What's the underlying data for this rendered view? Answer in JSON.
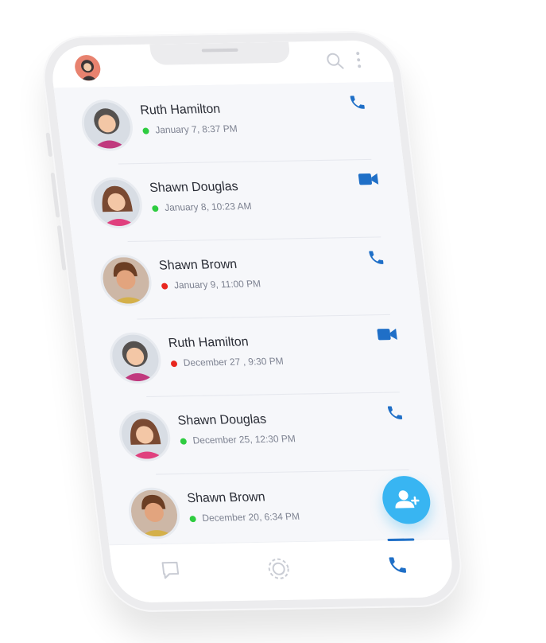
{
  "colors": {
    "accent": "#1f6fc7",
    "fab": "#38b5f2",
    "online": "#2ecc40",
    "missed": "#e8261e"
  },
  "header": {
    "avatar_icon": "user-avatar-icon",
    "search_icon": "search-icon",
    "menu_icon": "more-vertical-icon"
  },
  "calls": [
    {
      "name": "Ruth Hamilton",
      "time": "January 7, 8:37 PM",
      "status": "online",
      "action_icon": "phone-icon",
      "avatar": "woman-curly-hair"
    },
    {
      "name": "Shawn Douglas",
      "time": "January 8, 10:23 AM",
      "status": "online",
      "action_icon": "video-icon",
      "avatar": "woman-brown-hair"
    },
    {
      "name": "Shawn Brown",
      "time": "January 9, 11:00 PM",
      "status": "missed",
      "action_icon": "phone-icon",
      "avatar": "man-brown-hair"
    },
    {
      "name": "Ruth Hamilton",
      "time": "December 27 , 9:30 PM",
      "status": "missed",
      "action_icon": "video-icon",
      "avatar": "woman-curly-hair"
    },
    {
      "name": "Shawn Douglas",
      "time": "December 25, 12:30 PM",
      "status": "online",
      "action_icon": "phone-icon",
      "avatar": "woman-brown-hair"
    },
    {
      "name": "Shawn Brown",
      "time": "December 20, 6:34 PM",
      "status": "online",
      "action_icon": "phone-icon",
      "avatar": "man-brown-hair"
    }
  ],
  "fab": {
    "icon": "add-user-icon"
  },
  "bottom_nav": [
    {
      "icon": "chat-icon",
      "active": false
    },
    {
      "icon": "status-icon",
      "active": false
    },
    {
      "icon": "phone-icon",
      "active": true
    }
  ]
}
